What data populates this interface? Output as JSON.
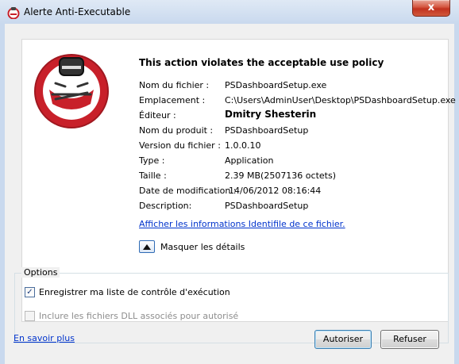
{
  "window": {
    "title": "Alerte Anti-Executable",
    "close_label": "x"
  },
  "alert": {
    "headline": "This action violates the acceptable use policy",
    "fields": [
      {
        "label": "Nom du fichier :",
        "value": "PSDashboardSetup.exe"
      },
      {
        "label": "Emplacement :",
        "value": "C:\\Users\\AdminUser\\Desktop\\PSDashboardSetup.exe"
      },
      {
        "label": "Éditeur :",
        "value": "Dmitry Shesterin"
      },
      {
        "label": "Nom du produit :",
        "value": "PSDashboardSetup"
      },
      {
        "label": "Version du fichier :",
        "value": "1.0.0.10"
      },
      {
        "label": "Type :",
        "value": "Application"
      },
      {
        "label": "Taille :",
        "value": "2.39 MB(2507136 octets)"
      },
      {
        "label": "Date de modification :",
        "value": "14/06/2012 08:16:44"
      },
      {
        "label": "Description:",
        "value": "PSDashboardSetup"
      }
    ],
    "info_link": "Afficher les informations Identifile de ce fichier.",
    "toggle_details_label": "Masquer les détails"
  },
  "options": {
    "title": "Options",
    "checkbox_register": {
      "label": "Enregistrer ma liste de contrôle d'exécution",
      "checked": true
    },
    "checkbox_dll": {
      "label": "Inclure les fichiers DLL associés pour autorisé",
      "checked": false,
      "disabled": true
    }
  },
  "footer": {
    "learn_more": "En savoir plus",
    "allow_button": "Autoriser",
    "deny_button": "Refuser"
  },
  "icons": {
    "app": "shield-logo-icon",
    "logo": "faronics-guard-logo",
    "toggle": "collapse-up-arrow-icon"
  },
  "colors": {
    "logo_red": "#c8202a",
    "link_blue": "#0033cc"
  }
}
